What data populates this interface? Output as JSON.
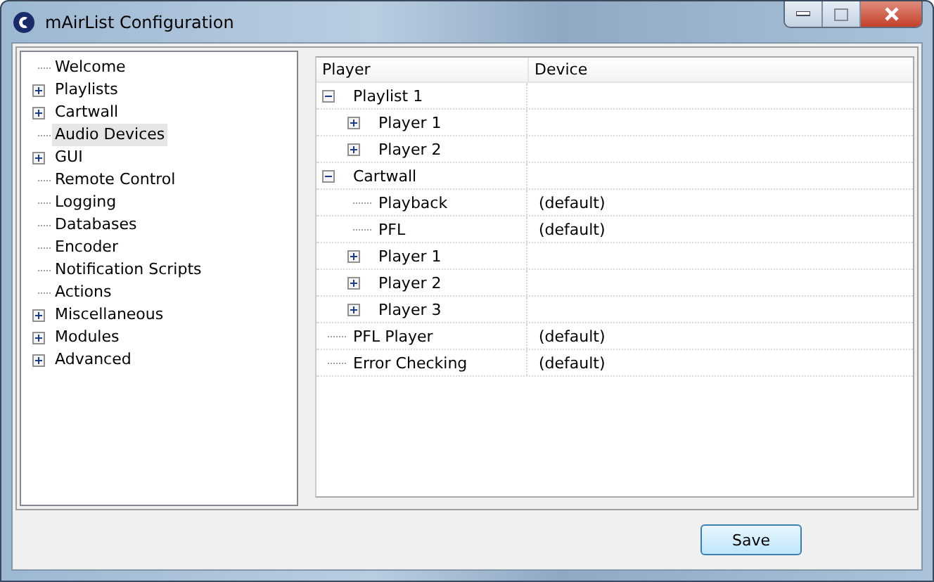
{
  "window": {
    "title": "mAirList Configuration"
  },
  "sidebar": {
    "items": [
      {
        "label": "Welcome",
        "kind": "page",
        "selected": false
      },
      {
        "label": "Playlists",
        "kind": "group",
        "expanded": false,
        "selected": false
      },
      {
        "label": "Cartwall",
        "kind": "group",
        "expanded": false,
        "selected": false
      },
      {
        "label": "Audio Devices",
        "kind": "page",
        "selected": true
      },
      {
        "label": "GUI",
        "kind": "group",
        "expanded": false,
        "selected": false
      },
      {
        "label": "Remote Control",
        "kind": "page",
        "selected": false
      },
      {
        "label": "Logging",
        "kind": "page",
        "selected": false
      },
      {
        "label": "Databases",
        "kind": "page",
        "selected": false
      },
      {
        "label": "Encoder",
        "kind": "page",
        "selected": false
      },
      {
        "label": "Notification Scripts",
        "kind": "page",
        "selected": false
      },
      {
        "label": "Actions",
        "kind": "page",
        "selected": false
      },
      {
        "label": "Miscellaneous",
        "kind": "group",
        "expanded": false,
        "selected": false
      },
      {
        "label": "Modules",
        "kind": "group",
        "expanded": false,
        "selected": false
      },
      {
        "label": "Advanced",
        "kind": "group",
        "expanded": false,
        "selected": false
      }
    ]
  },
  "table": {
    "columns": [
      "Player",
      "Device"
    ],
    "rows": [
      {
        "label": "Playlist 1",
        "kind": "group",
        "expanded": true,
        "children": [
          {
            "label": "Player 1",
            "kind": "group",
            "expanded": false
          },
          {
            "label": "Player 2",
            "kind": "group",
            "expanded": false
          }
        ]
      },
      {
        "label": "Cartwall",
        "kind": "group",
        "expanded": true,
        "children": [
          {
            "label": "Playback",
            "kind": "leaf",
            "device": "(default)"
          },
          {
            "label": "PFL",
            "kind": "leaf",
            "device": "(default)"
          },
          {
            "label": "Player 1",
            "kind": "group",
            "expanded": false
          },
          {
            "label": "Player 2",
            "kind": "group",
            "expanded": false
          },
          {
            "label": "Player 3",
            "kind": "group",
            "expanded": false
          }
        ]
      },
      {
        "label": "PFL Player",
        "kind": "leaf",
        "device": "(default)"
      },
      {
        "label": "Error Checking",
        "kind": "leaf",
        "device": "(default)"
      }
    ]
  },
  "buttons": [
    "Save"
  ]
}
